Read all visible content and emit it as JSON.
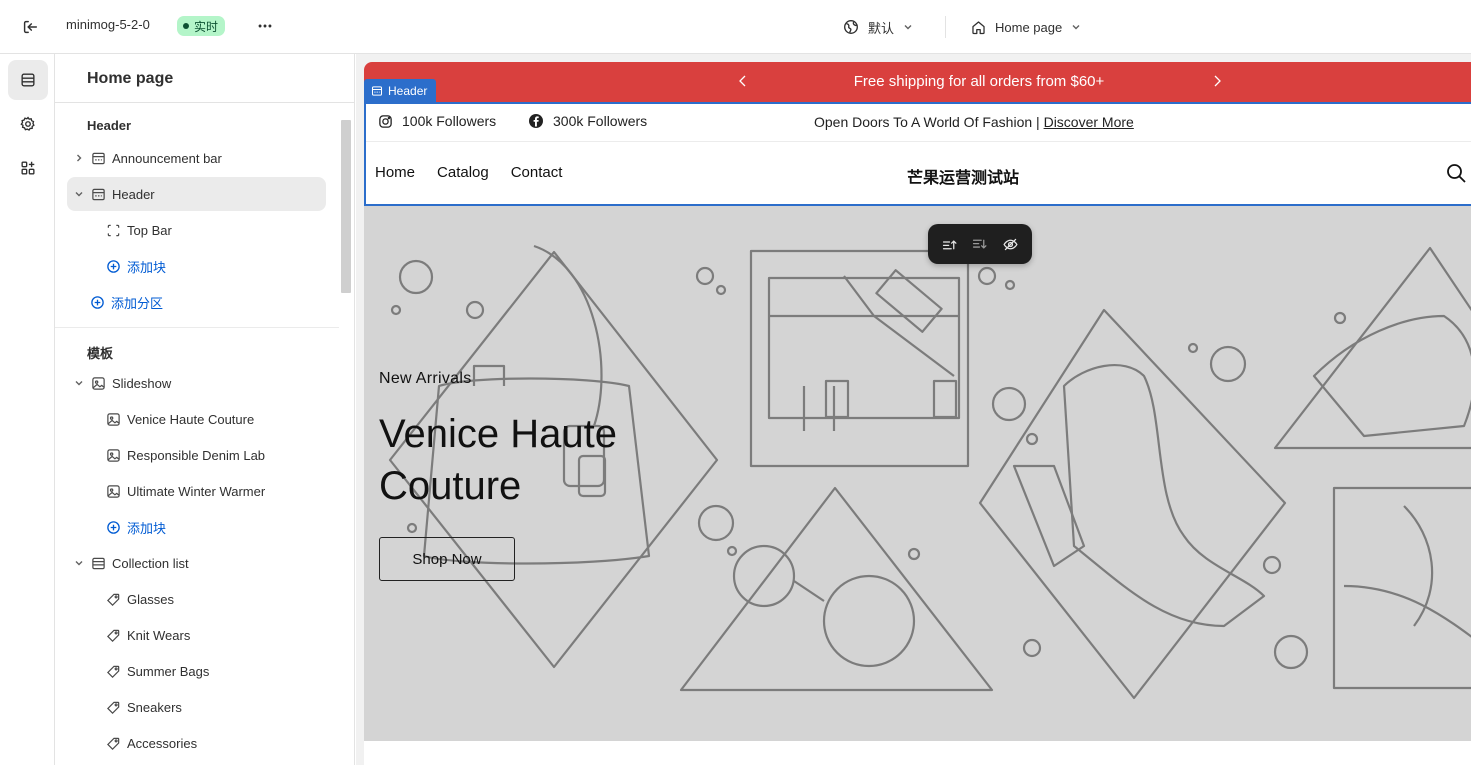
{
  "topbar": {
    "theme_name": "minimog-5-2-0",
    "live_badge": "实时",
    "language": "默认",
    "page_selector": "Home page"
  },
  "sidebar": {
    "title": "Home page",
    "header_group": "Header",
    "header_items": [
      {
        "label": "Announcement bar"
      },
      {
        "label": "Header"
      },
      {
        "label": "Top Bar"
      },
      {
        "label": "添加块"
      }
    ],
    "add_section": "添加分区",
    "template_group": "模板",
    "template_items": [
      {
        "label": "Slideshow"
      },
      {
        "label": "Venice Haute Couture"
      },
      {
        "label": "Responsible Denim Lab"
      },
      {
        "label": "Ultimate Winter Warmer"
      },
      {
        "label": "添加块"
      },
      {
        "label": "Collection list"
      },
      {
        "label": "Glasses"
      },
      {
        "label": "Knit Wears"
      },
      {
        "label": "Summer Bags"
      },
      {
        "label": "Sneakers"
      },
      {
        "label": "Accessories"
      }
    ]
  },
  "preview": {
    "announcement": "Free shipping for all orders from $60+",
    "header_tag": "Header",
    "instagram_followers": "100k Followers",
    "facebook_followers": "300k Followers",
    "topbar_text": "Open Doors To A World Of Fashion |",
    "topbar_link": "Discover More",
    "nav": [
      "Home",
      "Catalog",
      "Contact"
    ],
    "brand": "芒果运营测试站",
    "hero": {
      "subtitle": "New Arrivals",
      "title": "Venice Haute Couture",
      "button": "Shop Now"
    }
  },
  "colors": {
    "announcement_bg": "#d9403e",
    "selection_blue": "#2c6ecb",
    "live_badge_bg": "#b4f5c9",
    "hero_bg": "#d4d4d4"
  }
}
